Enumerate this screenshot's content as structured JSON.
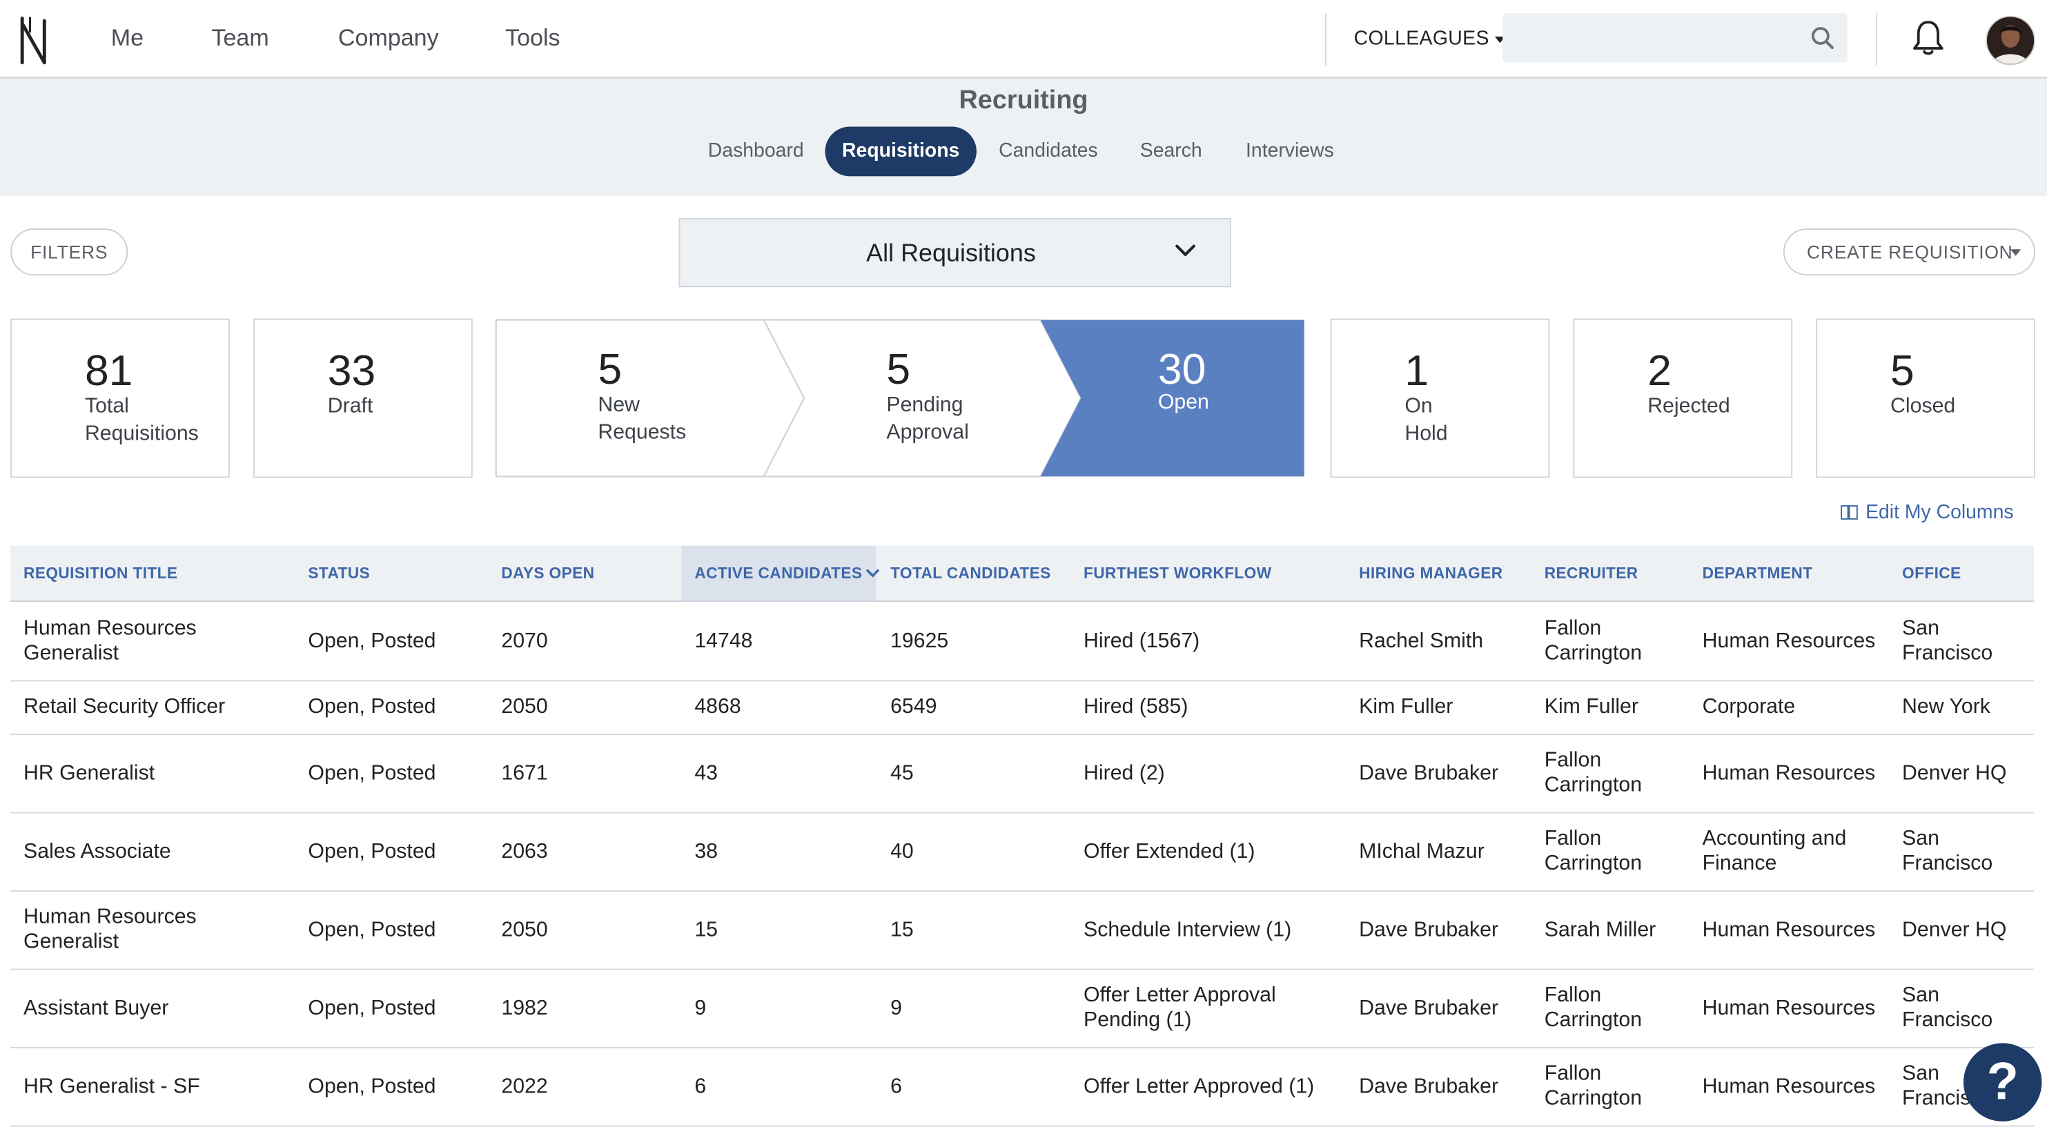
{
  "nav": {
    "items": [
      "Me",
      "Team",
      "Company",
      "Tools"
    ],
    "colleagues_label": "COLLEAGUES",
    "search_placeholder": ""
  },
  "header": {
    "title": "Recruiting",
    "tabs": [
      "Dashboard",
      "Requisitions",
      "Candidates",
      "Search",
      "Interviews"
    ],
    "active_tab": "Requisitions"
  },
  "controls": {
    "filters_label": "FILTERS",
    "requisition_filter": "All Requisitions",
    "create_label": "CREATE REQUISITION"
  },
  "stats": [
    {
      "count": "81",
      "label_1": "Total",
      "label_2": "Requisitions"
    },
    {
      "count": "33",
      "label_1": "Draft",
      "label_2": ""
    },
    {
      "count": "5",
      "label_1": "New",
      "label_2": "Requests"
    },
    {
      "count": "5",
      "label_1": "Pending",
      "label_2": "Approval"
    },
    {
      "count": "30",
      "label_1": "Open",
      "label_2": ""
    },
    {
      "count": "1",
      "label_1": "On",
      "label_2": "Hold"
    },
    {
      "count": "2",
      "label_1": "Rejected",
      "label_2": ""
    },
    {
      "count": "5",
      "label_1": "Closed",
      "label_2": ""
    }
  ],
  "edit_columns_label": "Edit My Columns",
  "table": {
    "columns": [
      "REQUISITION TITLE",
      "STATUS",
      "DAYS OPEN",
      "ACTIVE CANDIDATES",
      "TOTAL CANDIDATES",
      "FURTHEST WORKFLOW",
      "HIRING MANAGER",
      "RECRUITER",
      "DEPARTMENT",
      "OFFICE"
    ],
    "rows": [
      {
        "title": [
          "Human Resources",
          "Generalist"
        ],
        "status": "Open, Posted",
        "days": "2070",
        "active": "14748",
        "total": "19625",
        "workflow": [
          "Hired (1567)",
          ""
        ],
        "manager": "Rachel Smith",
        "recruiter": [
          "Fallon",
          "Carrington"
        ],
        "department": [
          "Human Resources",
          ""
        ],
        "office": [
          "San",
          "Francisco"
        ]
      },
      {
        "title": [
          "Retail Security Officer",
          ""
        ],
        "status": "Open, Posted",
        "days": "2050",
        "active": "4868",
        "total": "6549",
        "workflow": [
          "Hired (585)",
          ""
        ],
        "manager": "Kim Fuller",
        "recruiter": [
          "Kim Fuller",
          ""
        ],
        "department": [
          "Corporate",
          ""
        ],
        "office": [
          "New York",
          ""
        ]
      },
      {
        "title": [
          "HR Generalist",
          ""
        ],
        "status": "Open, Posted",
        "days": "1671",
        "active": "43",
        "total": "45",
        "workflow": [
          "Hired (2)",
          ""
        ],
        "manager": "Dave Brubaker",
        "recruiter": [
          "Fallon",
          "Carrington"
        ],
        "department": [
          "Human Resources",
          ""
        ],
        "office": [
          "Denver HQ",
          ""
        ]
      },
      {
        "title": [
          "Sales Associate",
          ""
        ],
        "status": "Open, Posted",
        "days": "2063",
        "active": "38",
        "total": "40",
        "workflow": [
          "Offer Extended (1)",
          ""
        ],
        "manager": "MIchal Mazur",
        "recruiter": [
          "Fallon",
          "Carrington"
        ],
        "department": [
          "Accounting and",
          "Finance"
        ],
        "office": [
          "San",
          "Francisco"
        ]
      },
      {
        "title": [
          "Human Resources",
          "Generalist"
        ],
        "status": "Open, Posted",
        "days": "2050",
        "active": "15",
        "total": "15",
        "workflow": [
          "Schedule Interview (1)",
          ""
        ],
        "manager": "Dave Brubaker",
        "recruiter": [
          "Sarah Miller",
          ""
        ],
        "department": [
          "Human Resources",
          ""
        ],
        "office": [
          "Denver HQ",
          ""
        ]
      },
      {
        "title": [
          "Assistant Buyer",
          ""
        ],
        "status": "Open, Posted",
        "days": "1982",
        "active": "9",
        "total": "9",
        "workflow": [
          "Offer Letter Approval",
          "Pending (1)"
        ],
        "manager": "Dave Brubaker",
        "recruiter": [
          "Fallon",
          "Carrington"
        ],
        "department": [
          "Human Resources",
          ""
        ],
        "office": [
          "San",
          "Francisco"
        ]
      },
      {
        "title": [
          "HR Generalist - SF",
          ""
        ],
        "status": "Open, Posted",
        "days": "2022",
        "active": "6",
        "total": "6",
        "workflow": [
          "Offer Letter Approved (1)",
          ""
        ],
        "manager": "Dave Brubaker",
        "recruiter": [
          "Fallon",
          "Carrington"
        ],
        "department": [
          "Human Resources",
          ""
        ],
        "office": [
          "San",
          "Francisco"
        ]
      }
    ]
  },
  "help_label": "?",
  "colors": {
    "navy": "#1e3a66",
    "open_stage": "#5b80c1",
    "link": "#3e67a8",
    "header_bg": "#eef1f4"
  }
}
